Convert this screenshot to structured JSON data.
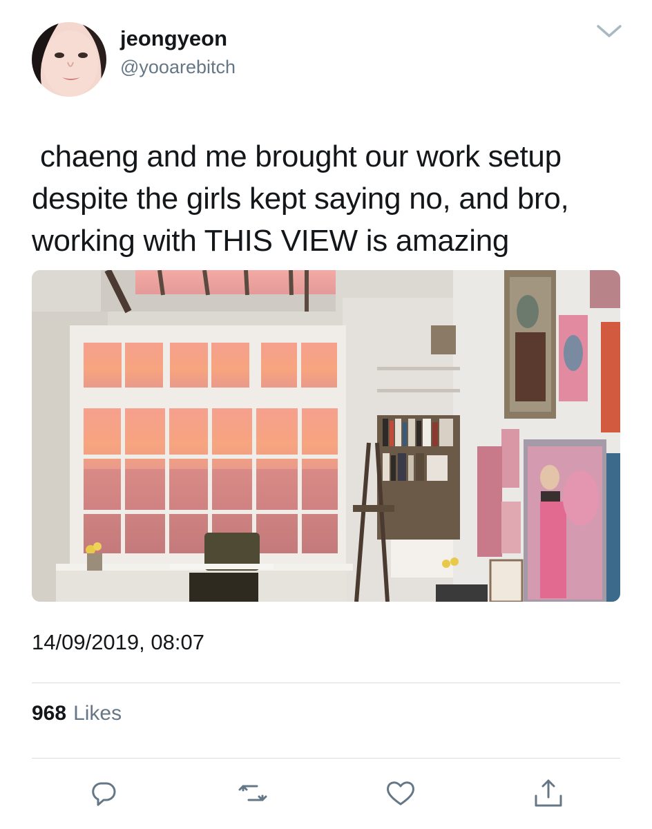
{
  "tweet": {
    "display_name": "jeongyeon",
    "handle": "@yooarebitch",
    "text": " chaeng and me brought our work setup\ndespite the girls kept saying no, and bro,\nworking with THIS VIEW is amazing",
    "timestamp": "14/09/2019, 08:07",
    "likes_count": "968",
    "likes_label": "Likes"
  },
  "colors": {
    "text": "#14171a",
    "secondary": "#657786",
    "divider": "#d6dde3",
    "sky_pink": "#f39a8e"
  },
  "icons": {
    "menu": "chevron-down-icon",
    "reply": "reply-icon",
    "retweet": "retweet-icon",
    "like": "heart-icon",
    "share": "share-icon"
  }
}
